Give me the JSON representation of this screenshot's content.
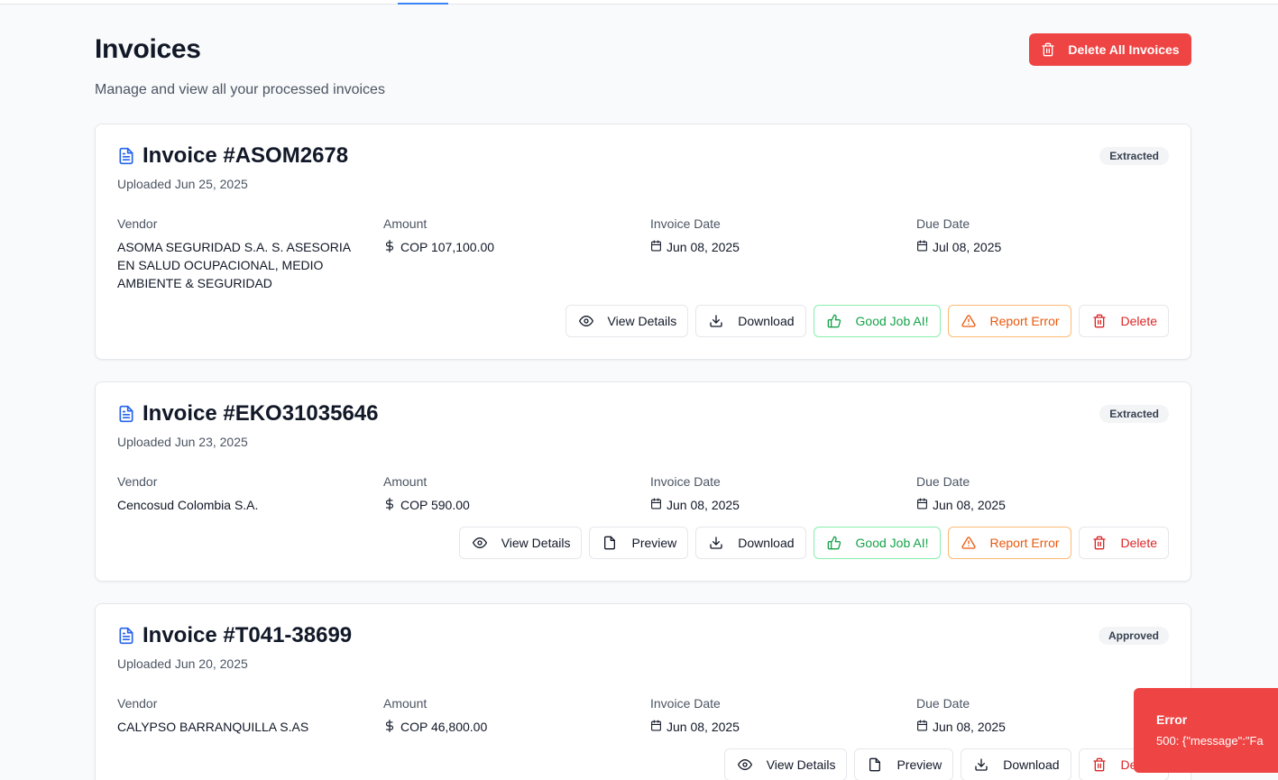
{
  "header": {
    "title": "Invoices",
    "subtitle": "Manage and view all your processed invoices",
    "delete_all_label": "Delete All Invoices"
  },
  "labels": {
    "vendor": "Vendor",
    "amount": "Amount",
    "invoice_date": "Invoice Date",
    "due_date": "Due Date"
  },
  "buttons": {
    "view_details": "View Details",
    "preview": "Preview",
    "download": "Download",
    "good_job": "Good Job AI!",
    "report_error": "Report Error",
    "delete": "Delete"
  },
  "invoices": [
    {
      "title": "Invoice #ASOM2678",
      "uploaded": "Uploaded Jun 25, 2025",
      "status": "Extracted",
      "vendor": "ASOMA SEGURIDAD S.A. S. ASESORIA EN SALUD OCUPACIONAL, MEDIO AMBIENTE & SEGURIDAD",
      "amount": "COP 107,100.00",
      "invoice_date": "Jun 08, 2025",
      "due_date": "Jul 08, 2025"
    },
    {
      "title": "Invoice #EKO31035646",
      "uploaded": "Uploaded Jun 23, 2025",
      "status": "Extracted",
      "vendor": "Cencosud Colombia S.A.",
      "amount": "COP 590.00",
      "invoice_date": "Jun 08, 2025",
      "due_date": "Jun 08, 2025"
    },
    {
      "title": "Invoice #T041-38699",
      "uploaded": "Uploaded Jun 20, 2025",
      "status": "Approved",
      "vendor": "CALYPSO BARRANQUILLA S.AS",
      "amount": "COP 46,800.00",
      "invoice_date": "Jun 08, 2025",
      "due_date": "Jun 08, 2025"
    }
  ],
  "toast": {
    "title": "Error",
    "message": "500: {\"message\":\"Fa"
  },
  "colors": {
    "primary_danger": "#ef4444",
    "accent_blue": "#3b82f6",
    "success_green": "#16a34a",
    "warning_orange": "#ea580c"
  }
}
